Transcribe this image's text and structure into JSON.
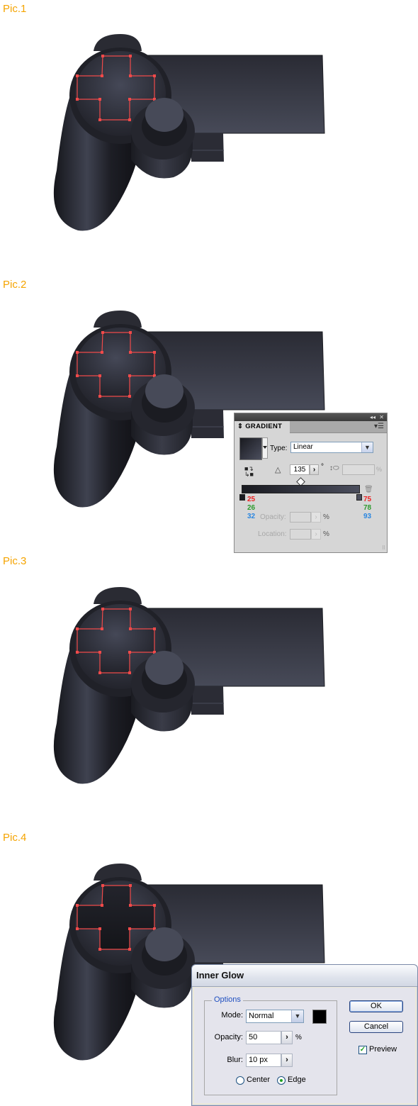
{
  "pics": [
    {
      "label": "Pic.1"
    },
    {
      "label": "Pic.2"
    },
    {
      "label": "Pic.3"
    },
    {
      "label": "Pic.4"
    }
  ],
  "colors": {
    "label_orange": "#f5a400",
    "path_red": "#f04a4a",
    "controller_dark": "#1d1e25",
    "controller_light": "#4b4e5d"
  },
  "gradient_panel": {
    "collapse_icon": "double-arrow-icon",
    "close_icon": "close-icon",
    "tab_label": "GRADIENT",
    "tab_prefix": "⇕",
    "menu_icon": "panel-menu-icon",
    "type_label": "Type:",
    "type_value": "Linear",
    "angle_value": "135",
    "degree_symbol": "°",
    "aspect_pct": "%",
    "left_stop": {
      "r": "25",
      "g": "26",
      "b": "32"
    },
    "right_stop": {
      "r": "75",
      "g": "78",
      "b": "93"
    },
    "opacity_label": "Opacity:",
    "location_label": "Location:",
    "pct": "%"
  },
  "inner_glow": {
    "title": "Inner Glow",
    "options_legend": "Options",
    "mode_label": "Mode:",
    "mode_value": "Normal",
    "glow_color": "#000000",
    "opacity_label": "Opacity:",
    "opacity_value": "50",
    "opacity_unit": "%",
    "blur_label": "Blur:",
    "blur_value": "10 px",
    "center_label": "Center",
    "edge_label": "Edge",
    "selected_source": "Edge",
    "ok_label": "OK",
    "cancel_label": "Cancel",
    "preview_label": "Preview",
    "preview_checked": true
  }
}
